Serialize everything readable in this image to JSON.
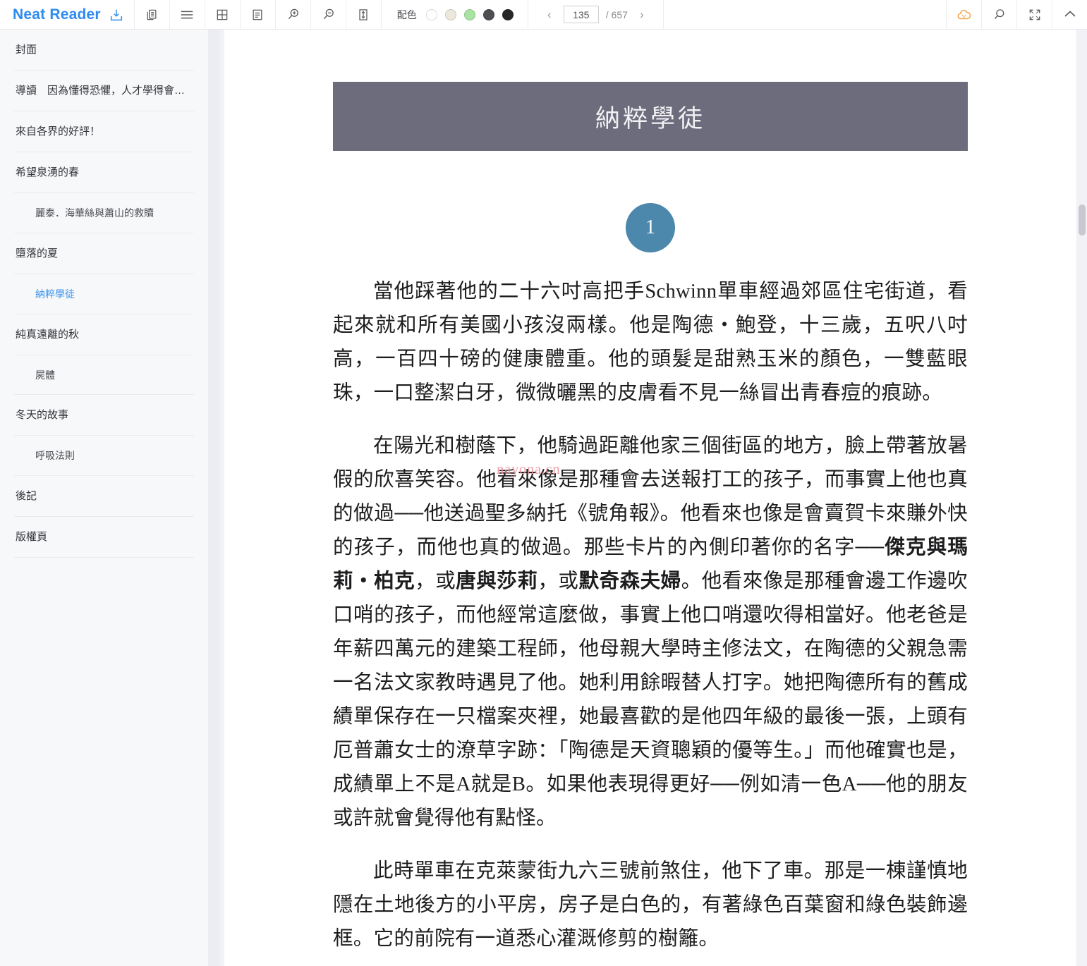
{
  "app": {
    "brand": "Neat Reader",
    "brand_color": "#2e8bef",
    "save_icon": "save-to-library-icon"
  },
  "toolbar": {
    "buttons": [
      {
        "name": "copy-book-icon",
        "tip": "Copy"
      },
      {
        "name": "toc-list-icon",
        "tip": "Table of contents"
      },
      {
        "name": "grid-layout-icon",
        "tip": "Grid layout"
      },
      {
        "name": "single-column-icon",
        "tip": "Single column"
      },
      {
        "name": "zoom-in-icon",
        "tip": "Zoom in"
      },
      {
        "name": "zoom-out-icon",
        "tip": "Zoom out"
      },
      {
        "name": "line-height-icon",
        "tip": "Line spacing"
      }
    ],
    "color_scheme": {
      "label": "配色",
      "swatches": [
        {
          "name": "swatch-white",
          "color": "#ffffff"
        },
        {
          "name": "swatch-cream",
          "color": "#ece9dc"
        },
        {
          "name": "swatch-green",
          "color": "#a8e3a2"
        },
        {
          "name": "swatch-gray",
          "color": "#4e4e52"
        },
        {
          "name": "swatch-black",
          "color": "#272729"
        }
      ]
    },
    "pager": {
      "prev_label": "‹",
      "next_label": "›",
      "current_page": "135",
      "total_label": "/ 657"
    },
    "right_buttons": [
      {
        "name": "cloud-sync-icon",
        "tip": "Cloud",
        "color": "#f0a44a"
      },
      {
        "name": "search-icon",
        "tip": "Search",
        "color": "#5a5a5f"
      },
      {
        "name": "fullscreen-icon",
        "tip": "Fullscreen",
        "color": "#5a5a5f"
      },
      {
        "name": "collapse-up-icon",
        "tip": "Collapse",
        "color": "#5a5a5f"
      }
    ]
  },
  "sidebar": {
    "items": [
      {
        "label": "封面",
        "level": 1,
        "active": false
      },
      {
        "label": "導讀　因為懂得恐懼，人才學得會溫柔…",
        "level": 1,
        "active": false
      },
      {
        "label": "來自各界的好評！",
        "level": 1,
        "active": false
      },
      {
        "label": "希望泉湧的春",
        "level": 1,
        "active": false
      },
      {
        "label": "麗泰．海華絲與蕭山的救贖",
        "level": 2,
        "active": false
      },
      {
        "label": "墮落的夏",
        "level": 1,
        "active": false
      },
      {
        "label": "納粹學徒",
        "level": 2,
        "active": true
      },
      {
        "label": "純真遠離的秋",
        "level": 1,
        "active": false
      },
      {
        "label": "屍體",
        "level": 2,
        "active": false
      },
      {
        "label": "冬天的故事",
        "level": 1,
        "active": false
      },
      {
        "label": "呼吸法則",
        "level": 2,
        "active": false
      },
      {
        "label": "後記",
        "level": 1,
        "active": false
      },
      {
        "label": "版權頁",
        "level": 1,
        "active": false
      }
    ]
  },
  "content": {
    "chapter_title": "納粹學徒",
    "chapter_banner_color": "#6d6c7c",
    "section_number": "1",
    "section_badge_color": "#4c87ac",
    "watermark": "nayona.cn",
    "paragraphs": [
      "當他踩著他的二十六吋高把手Schwinn單車經過郊區住宅街道，看起來就和所有美國小孩沒兩樣。他是陶德‧鮑登，十三歲，五呎八吋高，一百四十磅的健康體重。他的頭髮是甜熟玉米的顏色，一雙藍眼珠，一口整潔白牙，微微曬黑的皮膚看不見一絲冒出青春痘的痕跡。",
      "此時單車在克萊蒙街九六三號前煞住，他下了車。那是一棟謹慎地隱在土地後方的小平房，房子是白色的，有著綠色百葉窗和綠色裝飾邊框。它的前院有一道悉心灌溉修剪的樹籬。"
    ],
    "paragraph2": {
      "part1": "在陽光和樹蔭下，他騎過距離他家三個街區的地方，臉上帶著放暑假的欣喜笑容。他看來像是那種會去送報打工的孩子，而事實上他也真的做過──他送過聖多納托《號角報》。他看來也像是會賣賀卡來賺外快的孩子，而他也真的做過。那些卡片的內側印著你的名字──",
      "bold1": "傑克與瑪莉‧柏克",
      "mid1": "，或",
      "bold2": "唐與莎莉",
      "mid2": "，或",
      "bold3": "默奇森夫婦",
      "part2": "。他看來像是那種會邊工作邊吹口哨的孩子，而他經常這麼做，事實上他口哨還吹得相當好。他老爸是年薪四萬元的建築工程師，他母親大學時主修法文，在陶德的父親急需一名法文家教時遇見了他。她利用餘暇替人打字。她把陶德所有的舊成績單保存在一只檔案夾裡，她最喜歡的是他四年級的最後一張，上頭有厄普蕭女士的潦草字跡：「陶德是天資聰穎的優等生。」而他確實也是，成績單上不是A就是B。如果他表現得更好──例如清一色A──他的朋友或許就會覺得他有點怪。"
    }
  }
}
